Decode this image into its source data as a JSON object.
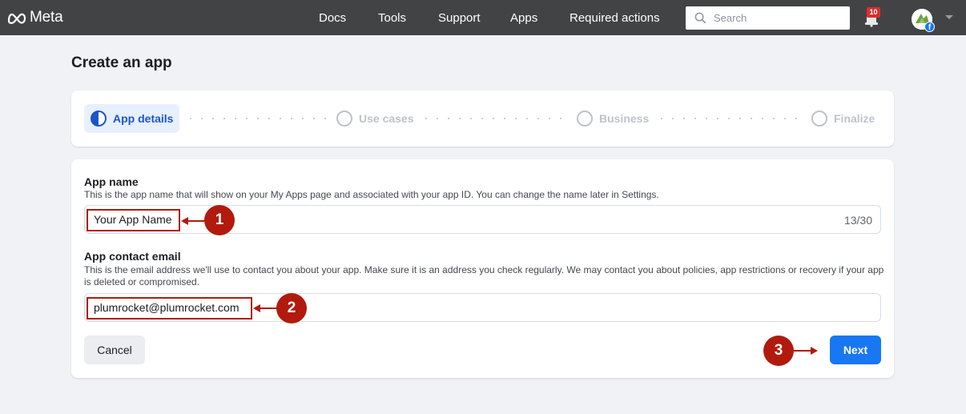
{
  "nav": {
    "logo_text": "Meta",
    "items": [
      {
        "label": "Docs"
      },
      {
        "label": "Tools"
      },
      {
        "label": "Support"
      },
      {
        "label": "Apps"
      },
      {
        "label": "Required actions"
      }
    ],
    "search_placeholder": "Search",
    "notifications_count": "10",
    "icons": [
      "meta-logo-icon",
      "search-icon",
      "notification-bell-icon",
      "avatar",
      "chevron-down-icon"
    ]
  },
  "page_title": "Create an app",
  "stepper": {
    "steps": [
      {
        "label": "App details",
        "state": "active"
      },
      {
        "label": "Use cases",
        "state": "pending"
      },
      {
        "label": "Business",
        "state": "pending"
      },
      {
        "label": "Finalize",
        "state": "pending"
      }
    ]
  },
  "form": {
    "app_name": {
      "label": "App name",
      "help": "This is the app name that will show on your My Apps page and associated with your app ID. You can change the name later in Settings.",
      "value": "Your App Name",
      "counter": "13/30"
    },
    "contact_email": {
      "label": "App contact email",
      "help": "This is the email address we'll use to contact you about your app. Make sure it is an address you check regularly. We may contact you about policies, app restrictions or recovery if your app is deleted or compromised.",
      "value": "plumrocket@plumrocket.com"
    },
    "cancel_label": "Cancel",
    "next_label": "Next"
  },
  "annotations": [
    {
      "number": "1"
    },
    {
      "number": "2"
    },
    {
      "number": "3"
    }
  ],
  "colors": {
    "topbar": "#424345",
    "accent": "#1877f2",
    "annotation": "#b21a0e",
    "active_step": "#1c55c9"
  }
}
